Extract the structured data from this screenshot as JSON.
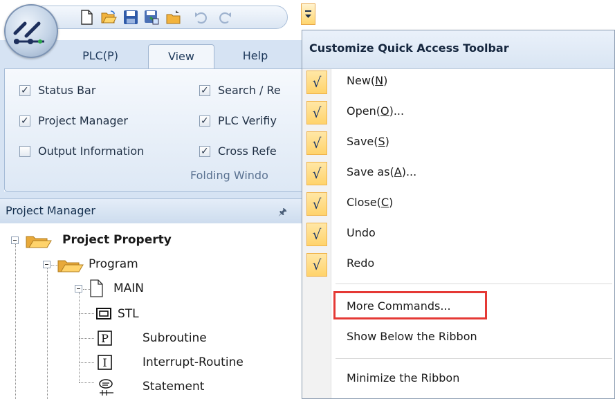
{
  "ribbon": {
    "tabs": [
      {
        "label": "PLC(P)",
        "active": false
      },
      {
        "label": "View",
        "active": true
      },
      {
        "label": "Help",
        "active": false
      }
    ],
    "checkboxes": [
      {
        "label": "Status Bar",
        "checked": true
      },
      {
        "label": "Project Manager",
        "checked": true
      },
      {
        "label": "Output Information",
        "checked": false
      },
      {
        "label": "Search / Re",
        "checked": true
      },
      {
        "label": "PLC Verifiy",
        "checked": true
      },
      {
        "label": "Cross Refe",
        "checked": true
      }
    ],
    "group_label": "Folding Windo"
  },
  "project_manager": {
    "title": "Project Manager",
    "pin_icon": "pin-icon",
    "tree": [
      {
        "label": "Project Property",
        "icon": "folder-icon"
      },
      {
        "label": "Program",
        "icon": "folder-icon"
      },
      {
        "label": "MAIN",
        "icon": "document-icon"
      },
      {
        "label": "STL",
        "icon": "stl-icon"
      },
      {
        "label": "Subroutine",
        "icon": "p-box-icon"
      },
      {
        "label": "Interrupt-Routine",
        "icon": "i-box-icon"
      },
      {
        "label": "Statement",
        "icon": "statement-icon"
      }
    ]
  },
  "menu": {
    "title": "Customize Quick Access Toolbar",
    "checked_items": [
      {
        "pre": "New(",
        "key": "N",
        "post": ")"
      },
      {
        "pre": "Open(",
        "key": "O",
        "post": ")..."
      },
      {
        "pre": "Save(",
        "key": "S",
        "post": ")"
      },
      {
        "pre": "Save as(",
        "key": "A",
        "post": ")..."
      },
      {
        "pre": "Close(",
        "key": "C",
        "post": ")"
      },
      {
        "pre": "Undo",
        "key": "",
        "post": ""
      },
      {
        "pre": "Redo",
        "key": "",
        "post": ""
      }
    ],
    "check_mark": "√",
    "more_commands": "More Commands...",
    "show_below": "Show Below the Ribbon",
    "minimize": "Minimize the Ribbon"
  },
  "colors": {
    "highlight_border": "#e53935",
    "check_bg": "#ffd36b",
    "ribbon_bg": "#d6e3f3"
  }
}
